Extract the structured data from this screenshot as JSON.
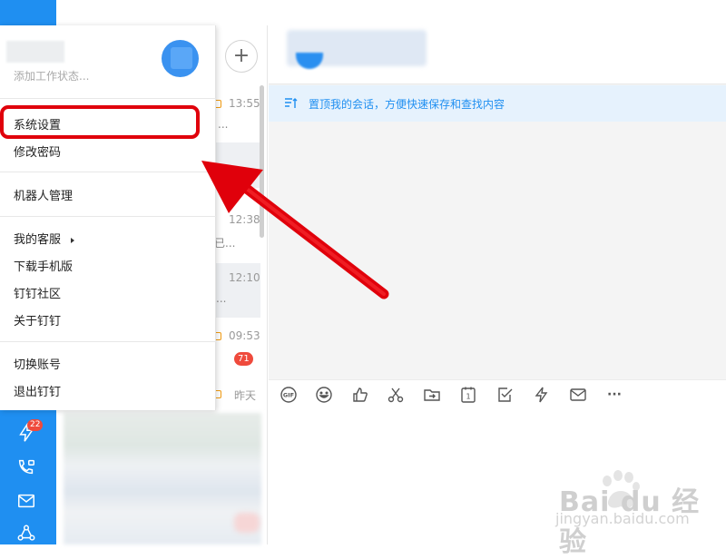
{
  "profile": {
    "status_placeholder": "添加工作状态..."
  },
  "menu": {
    "items": [
      {
        "label": "系统设置"
      },
      {
        "label": "修改密码"
      },
      {
        "label": "机器人管理"
      },
      {
        "label": "我的客服"
      },
      {
        "label": "下载手机版"
      },
      {
        "label": "钉钉社区"
      },
      {
        "label": "关于钉钉"
      },
      {
        "label": "切换账号"
      },
      {
        "label": "退出钉钉"
      }
    ]
  },
  "conversations": {
    "add_button": "+",
    "items": [
      {
        "time": "13:55",
        "snippet": "..."
      },
      {
        "time": "12:38",
        "snippet": "已..."
      },
      {
        "time": "12:10",
        "snippet": "..."
      },
      {
        "time": "09:53",
        "badge": "71"
      },
      {
        "time": "昨天"
      }
    ]
  },
  "rail": {
    "ding_badge": "22"
  },
  "chat": {
    "pin_tip": "置顶我的会话，方便快速保存和查找内容",
    "toolbar": [
      "gif-icon",
      "emoji-icon",
      "thumbs-up-icon",
      "scissors-icon",
      "file-transfer-icon",
      "calendar-icon",
      "checkbox-icon",
      "ding-icon",
      "mail-icon",
      "more-icon"
    ],
    "gif_label": "GIF",
    "calendar_label": "1",
    "more_label": "···"
  },
  "watermark": {
    "brand": "Bai du 经验",
    "url": "jingyan.baidu.com"
  },
  "colors": {
    "rail": "#1f8ff1",
    "highlight": "#e0000b",
    "badge": "#ef4a3c"
  }
}
